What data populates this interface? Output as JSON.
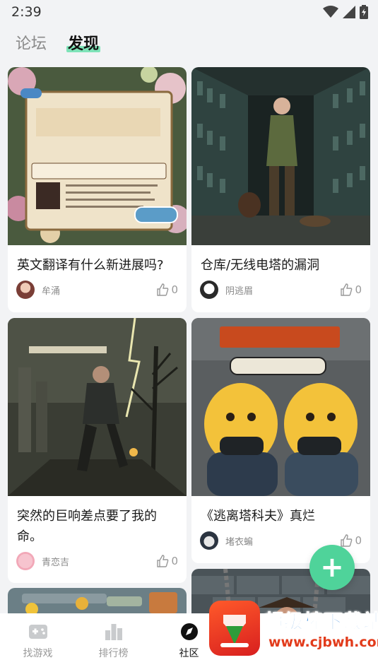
{
  "status_bar": {
    "time": "2:39"
  },
  "tabs": [
    {
      "label": "论坛",
      "active": false
    },
    {
      "label": "发现",
      "active": true
    }
  ],
  "posts": [
    {
      "title": "英文翻译有什么新进展吗?",
      "author": "牟涌",
      "likes": "0",
      "image": "illustrated-book-poster"
    },
    {
      "title": "仓库/无线电塔的漏洞",
      "author": "阴逃眉",
      "likes": "0",
      "image": "warehouse-survivor"
    },
    {
      "title": "突然的巨响差点要了我的命。",
      "author": "青恋吉",
      "likes": "0",
      "image": "running-survivor"
    },
    {
      "title": "《逃离塔科夫》真烂",
      "author": "堵衣蝙",
      "likes": "0",
      "image": "cartoon-gamers"
    },
    {
      "title": "",
      "author": "",
      "likes": "",
      "image": "game-items"
    },
    {
      "title": "",
      "author": "",
      "likes": "",
      "image": "chained-character"
    }
  ],
  "fab": {
    "symbol": "+"
  },
  "bottom_nav": [
    {
      "label": "找游戏",
      "icon": "gamepad-icon",
      "active": false
    },
    {
      "label": "排行榜",
      "icon": "bar-chart-icon",
      "active": false
    },
    {
      "label": "社区",
      "icon": "compass-icon",
      "active": true
    },
    {
      "label": "",
      "icon": "",
      "active": false
    },
    {
      "label": "",
      "icon": "",
      "active": false
    }
  ],
  "watermark": {
    "name": "超级棒下载站",
    "url": "www.cjbwh.com"
  },
  "colors": {
    "accent": "#4fd39a",
    "tab_highlight": "#7ee3b8",
    "background": "#f2f3f5"
  }
}
